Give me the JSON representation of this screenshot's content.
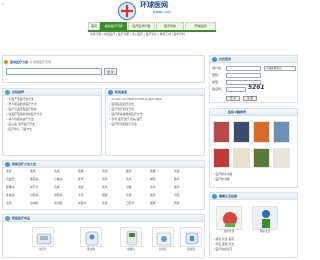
{
  "site": {
    "logo_text": "环球医网",
    "logo_sub": "94MD.com"
  },
  "nav": {
    "tabs": [
      "首页",
      "相关医疗问题",
      "医疗医学问答",
      "首页导航",
      "环球医网"
    ],
    "links_row1": [
      "免费问答",
      "常见医疗",
      "医疗诊断",
      "流入医疗",
      "医疗论坛",
      "健康工具",
      "医学百科"
    ],
    "links_row2": [
      "",
      "",
      "",
      "",
      "",
      "",
      ""
    ]
  },
  "search": {
    "label": "查询医疗方案",
    "hint": "请 常用医疗查询",
    "input_value": "",
    "button_label": "搜 索"
  },
  "section_left": {
    "title": "名院推荐",
    "items": [
      "全国严重医疗的方法",
      "男人疾病的新医疗方法",
      "医疗高血压和医疗健康",
      "新医疗医院提供的医疗方法",
      "病人的疾病治疗方法",
      "医心病 治疗医疗方法",
      "医疗中心 了解方法"
    ]
  },
  "section_mid": {
    "title": "新闻速递",
    "items": [
      "xbdbdcd7xd6eddcd0b1xbdbdcd0xb",
      "医院医院治疗新法",
      "医疗治疗的新方法",
      "医疗疾病常用的医疗方法",
      "新闻 医疗治疗 疾病 医疗",
      "医疗新闻的医疗方法"
    ]
  },
  "login": {
    "title": "会员登录",
    "user_label": "用户名：",
    "pass_label": "密码：",
    "type_label": "类型：",
    "code_label": "验证码：",
    "code_value": "5261",
    "select_value": "环球医网会员",
    "login_button": "登 录",
    "register_button": "注 册"
  },
  "books": {
    "title": "医院书籍推荐",
    "captions": [
      "医疗书籍",
      "医疗手册",
      "医学书籍",
      "医学指南"
    ],
    "links": [
      "医疗相关书籍",
      "医疗的书籍"
    ]
  },
  "diseases": {
    "title": "疾病治疗方法大全",
    "rows": [
      [
        "感冒",
        "发烧",
        "头痛",
        "咳嗽",
        "胃痛",
        "腹泻",
        "失眠",
        "贫血"
      ],
      [
        "高血压",
        "糖尿病",
        "心脏病",
        "肝炎",
        "肾炎",
        "胃炎",
        "哮喘",
        "肺炎"
      ],
      [
        "颈椎病",
        "关节炎",
        "痔疮",
        "湿疹",
        "皮炎",
        "过敏",
        "鼻炎",
        "咽炎"
      ],
      [
        "乳腺病",
        "妇科病",
        "男科病",
        "不孕",
        "阳痿",
        "早泄",
        "痛经",
        "月经"
      ],
      [
        "近视",
        "白内障",
        "青光眼",
        "中耳炎",
        "牙痛",
        "口腔炎",
        "肥胖",
        "骨折"
      ]
    ]
  },
  "products": {
    "title": "家庭医疗用品",
    "captions": [
      "血压计",
      "雾化器",
      "血糖仪",
      "制氧机",
      "按摩器"
    ]
  },
  "health": {
    "title": "健康生活指南",
    "captions": [
      "健康饮食",
      "健康生活"
    ],
    "links": [
      "健康 饮食 指南",
      "养生 保健 方法",
      "医疗健康生活"
    ]
  }
}
